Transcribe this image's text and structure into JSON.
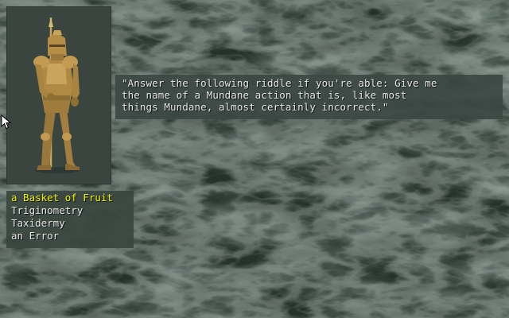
{
  "dialog": {
    "riddle_text": "\"Answer the following riddle if you're able: Give me\nthe name of a Mundane action that is, like most\nthings Mundane, almost certainly incorrect.\""
  },
  "answers": [
    {
      "label": "a Basket of Fruit",
      "selected": true
    },
    {
      "label": "Triginometry",
      "selected": false
    },
    {
      "label": "Taxidermy",
      "selected": false
    },
    {
      "label": "an Error",
      "selected": false
    }
  ],
  "colors": {
    "background": "#24302a",
    "text": "#e6e6e6",
    "highlight": "#f4f200",
    "armor": "#b08a44"
  },
  "icons": {
    "portrait": "armored-knight-with-spear",
    "cursor": "arrow-cursor"
  }
}
